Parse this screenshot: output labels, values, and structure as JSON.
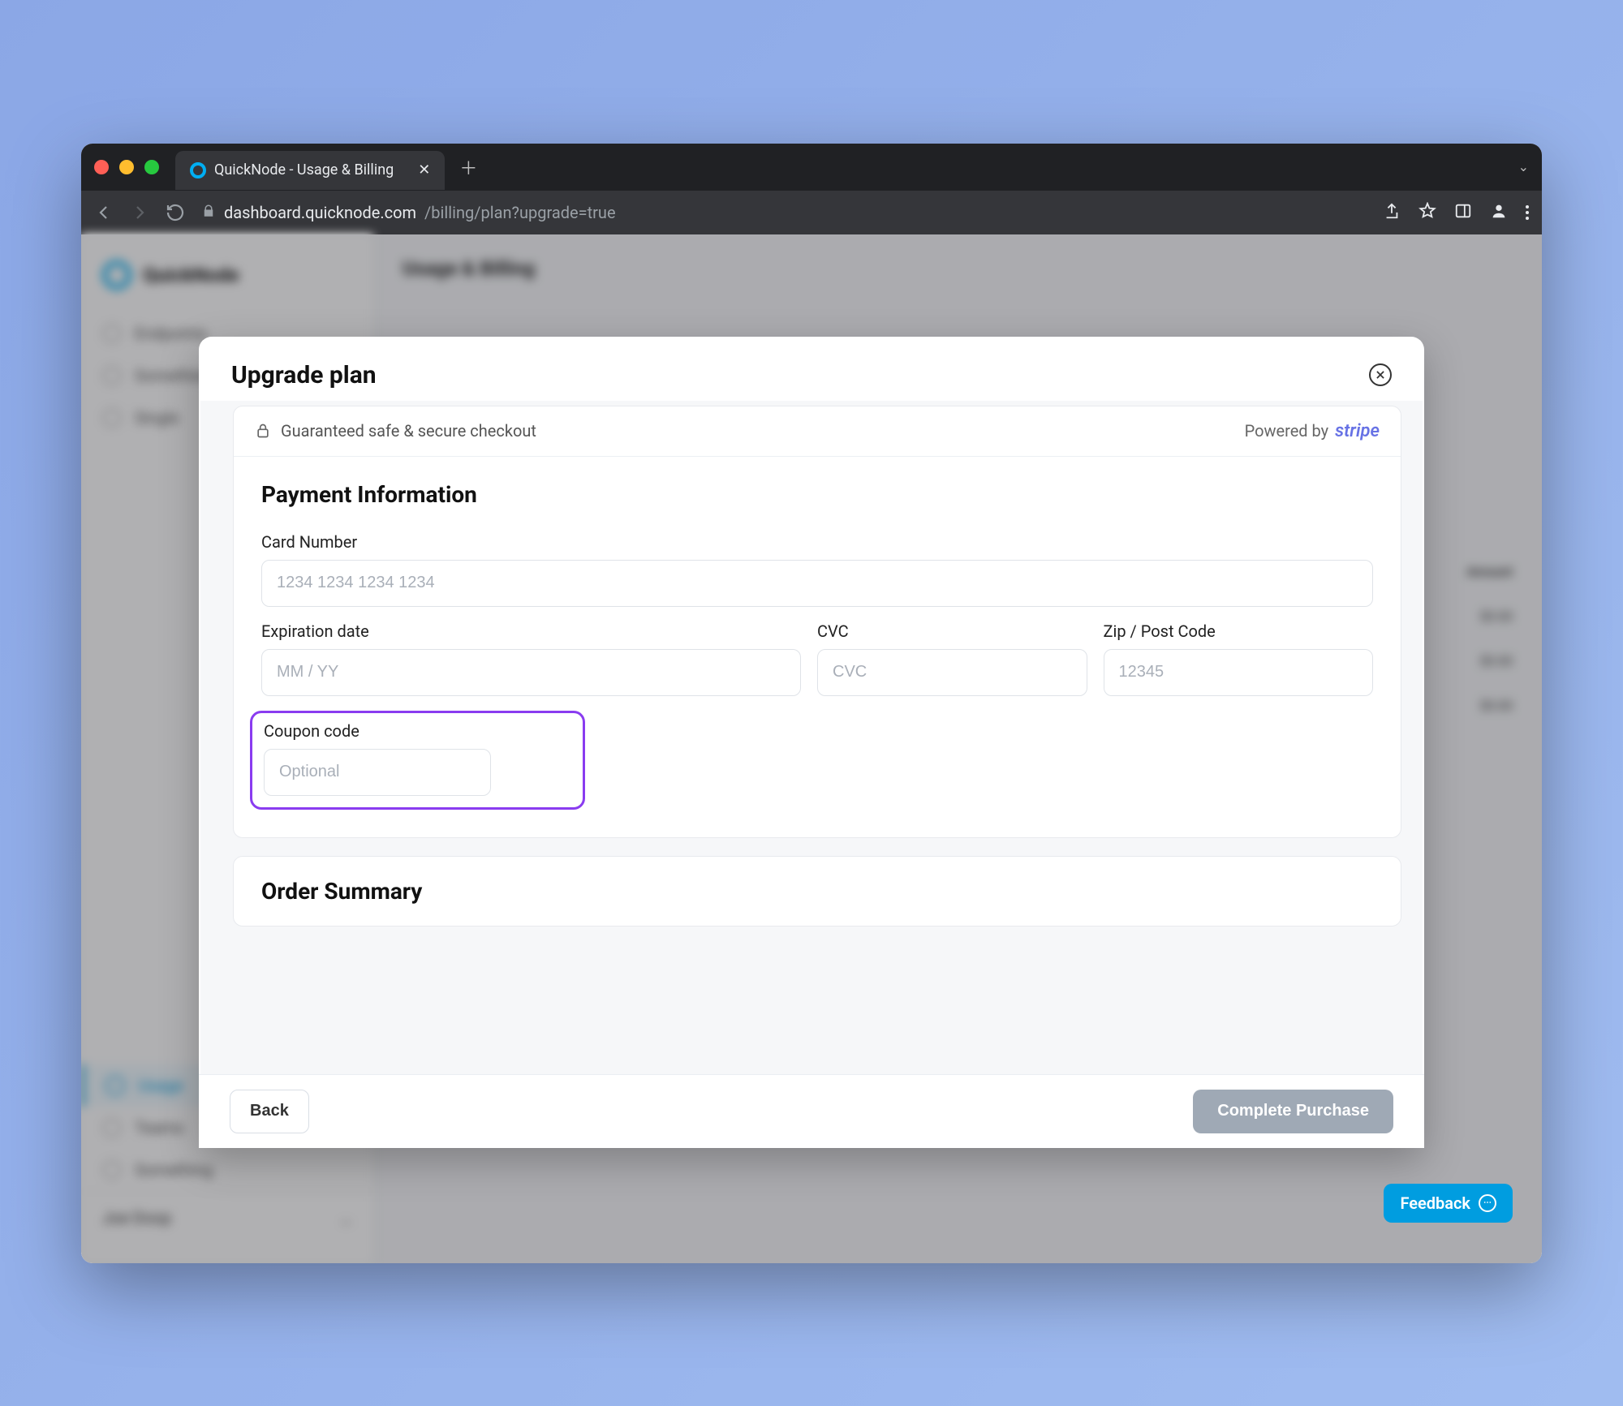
{
  "browser": {
    "tab_title": "QuickNode - Usage & Billing",
    "url_domain": "dashboard.quicknode.com",
    "url_path": "/billing/plan?upgrade=true"
  },
  "sidebar": {
    "brand": "QuickNode",
    "items": [
      {
        "label": "Endpoints"
      },
      {
        "label": "Something"
      },
      {
        "label": "Single"
      },
      {
        "label": "Usage"
      },
      {
        "label": "Teams"
      },
      {
        "label": "Something"
      }
    ],
    "user": "Joe Doop"
  },
  "main": {
    "crumb": "Usage & Billing",
    "amount_label": "Amount",
    "rows": [
      "$0.00",
      "$0.00",
      "$0.00"
    ]
  },
  "modal": {
    "title": "Upgrade plan",
    "secure_text": "Guaranteed safe & secure checkout",
    "powered_by": "Powered by",
    "stripe": "stripe",
    "section_payment": "Payment Information",
    "labels": {
      "card": "Card Number",
      "exp": "Expiration date",
      "cvc": "CVC",
      "zip": "Zip / Post Code",
      "coupon": "Coupon code"
    },
    "placeholders": {
      "card": "1234 1234 1234 1234",
      "exp": "MM / YY",
      "cvc": "CVC",
      "zip": "12345",
      "coupon": "Optional"
    },
    "section_order": "Order Summary",
    "back": "Back",
    "complete": "Complete Purchase"
  },
  "feedback": "Feedback"
}
